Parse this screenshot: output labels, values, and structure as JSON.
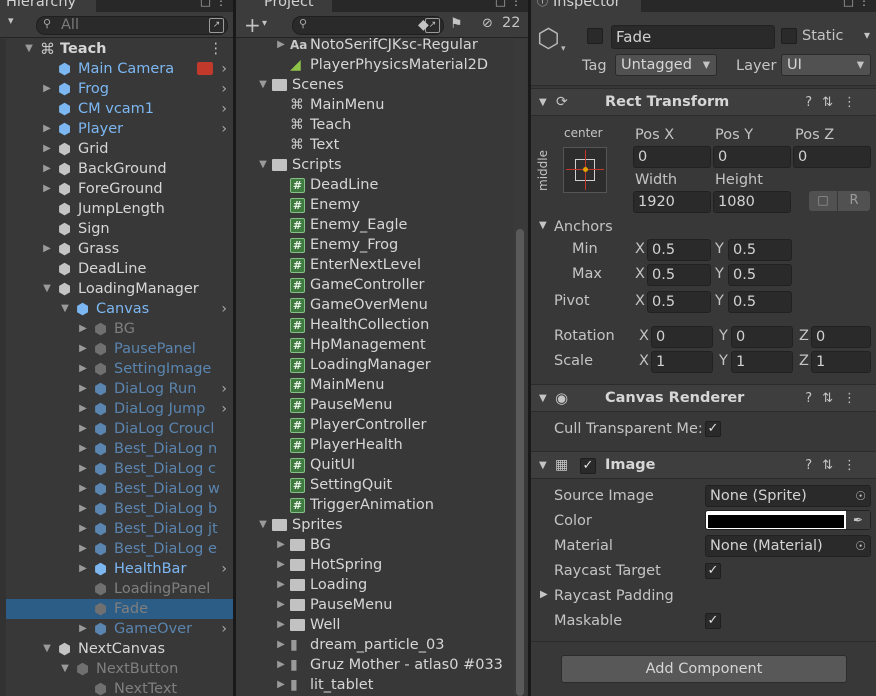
{
  "hierarchy": {
    "tab_label": "Hierarchy",
    "search_placeholder": "All",
    "add_label": "+",
    "rows": [
      {
        "label": "Teach",
        "indent": 1,
        "arrow": "down",
        "icon": "scene",
        "style": "white",
        "bold": true,
        "menu": true
      },
      {
        "label": "Main Camera",
        "indent": 2,
        "arrow": "",
        "icon": "cube-blue",
        "style": "blue",
        "chevron": true,
        "badge": true
      },
      {
        "label": "Frog",
        "indent": 2,
        "arrow": "right",
        "icon": "cube-blue",
        "style": "blue",
        "chevron": true
      },
      {
        "label": "CM vcam1",
        "indent": 2,
        "arrow": "",
        "icon": "cube-blue",
        "style": "blue",
        "chevron": true
      },
      {
        "label": "Player",
        "indent": 2,
        "arrow": "right",
        "icon": "cube-blue",
        "style": "blue",
        "chevron": true
      },
      {
        "label": "Grid",
        "indent": 2,
        "arrow": "right",
        "icon": "cube",
        "style": "white"
      },
      {
        "label": "BackGround",
        "indent": 2,
        "arrow": "right",
        "icon": "cube",
        "style": "white"
      },
      {
        "label": "ForeGround",
        "indent": 2,
        "arrow": "right",
        "icon": "cube",
        "style": "white"
      },
      {
        "label": "JumpLength",
        "indent": 2,
        "arrow": "",
        "icon": "cube",
        "style": "white"
      },
      {
        "label": "Sign",
        "indent": 2,
        "arrow": "",
        "icon": "cube",
        "style": "white"
      },
      {
        "label": "Grass",
        "indent": 2,
        "arrow": "right",
        "icon": "cube",
        "style": "white"
      },
      {
        "label": "DeadLine",
        "indent": 2,
        "arrow": "",
        "icon": "cube",
        "style": "white"
      },
      {
        "label": "LoadingManager",
        "indent": 2,
        "arrow": "down",
        "icon": "cube",
        "style": "white"
      },
      {
        "label": "Canvas",
        "indent": 3,
        "arrow": "down",
        "icon": "cube-blue",
        "style": "blue",
        "chevron": true
      },
      {
        "label": "BG",
        "indent": 4,
        "arrow": "right",
        "icon": "cube-dim",
        "style": "dim"
      },
      {
        "label": "PausePanel",
        "indent": 4,
        "arrow": "right",
        "icon": "cube-dim",
        "style": "dimblue"
      },
      {
        "label": "SettingImage",
        "indent": 4,
        "arrow": "right",
        "icon": "cube-dim",
        "style": "dimblue"
      },
      {
        "label": "DiaLog Run",
        "indent": 4,
        "arrow": "right",
        "icon": "cube-dimblue",
        "style": "dimblue",
        "chevron": true
      },
      {
        "label": "DiaLog Jump",
        "indent": 4,
        "arrow": "right",
        "icon": "cube-dimblue",
        "style": "dimblue",
        "chevron": true
      },
      {
        "label": "DiaLog Croucl",
        "indent": 4,
        "arrow": "right",
        "icon": "cube-dimblue",
        "style": "dimblue"
      },
      {
        "label": "Best_DiaLog n",
        "indent": 4,
        "arrow": "right",
        "icon": "cube-dimblue",
        "style": "dimblue"
      },
      {
        "label": "Best_DiaLog c",
        "indent": 4,
        "arrow": "right",
        "icon": "cube-dimblue",
        "style": "dimblue"
      },
      {
        "label": "Best_DiaLog w",
        "indent": 4,
        "arrow": "right",
        "icon": "cube-dimblue",
        "style": "dimblue"
      },
      {
        "label": "Best_DiaLog b",
        "indent": 4,
        "arrow": "right",
        "icon": "cube-dimblue",
        "style": "dimblue"
      },
      {
        "label": "Best_DiaLog jt",
        "indent": 4,
        "arrow": "right",
        "icon": "cube-dimblue",
        "style": "dimblue"
      },
      {
        "label": "Best_DiaLog e",
        "indent": 4,
        "arrow": "right",
        "icon": "cube-dimblue",
        "style": "dimblue"
      },
      {
        "label": "HealthBar",
        "indent": 4,
        "arrow": "right",
        "icon": "cube-blue",
        "style": "blue",
        "chevron": true
      },
      {
        "label": "LoadingPanel",
        "indent": 4,
        "arrow": "",
        "icon": "cube-dim",
        "style": "dim"
      },
      {
        "label": "Fade",
        "indent": 4,
        "arrow": "",
        "icon": "cube-dim",
        "style": "dim",
        "selected": true
      },
      {
        "label": "GameOver",
        "indent": 4,
        "arrow": "right",
        "icon": "cube-dimblue",
        "style": "dimblue",
        "chevron": true
      },
      {
        "label": "NextCanvas",
        "indent": 2,
        "arrow": "down",
        "icon": "cube",
        "style": "white"
      },
      {
        "label": "NextButton",
        "indent": 3,
        "arrow": "down",
        "icon": "cube-dim",
        "style": "dim"
      },
      {
        "label": "NextText",
        "indent": 4,
        "arrow": "",
        "icon": "cube-dim",
        "style": "dim"
      }
    ]
  },
  "project": {
    "tab_label": "Project",
    "add_label": "+",
    "hidden_count": "22",
    "rows": [
      {
        "label": "NotoSerifCJKsc-Regular",
        "indent": 2,
        "arrow": "right",
        "icon": "font"
      },
      {
        "label": "PlayerPhysicsMaterial2D",
        "indent": 2,
        "arrow": "",
        "icon": "physics"
      },
      {
        "label": "Scenes",
        "indent": 1,
        "arrow": "down",
        "icon": "folder"
      },
      {
        "label": "MainMenu",
        "indent": 2,
        "arrow": "",
        "icon": "scene"
      },
      {
        "label": "Teach",
        "indent": 2,
        "arrow": "",
        "icon": "scene"
      },
      {
        "label": "Text",
        "indent": 2,
        "arrow": "",
        "icon": "scene"
      },
      {
        "label": "Scripts",
        "indent": 1,
        "arrow": "down",
        "icon": "folder"
      },
      {
        "label": "DeadLine",
        "indent": 2,
        "arrow": "",
        "icon": "script"
      },
      {
        "label": "Enemy",
        "indent": 2,
        "arrow": "",
        "icon": "script"
      },
      {
        "label": "Enemy_Eagle",
        "indent": 2,
        "arrow": "",
        "icon": "script"
      },
      {
        "label": "Enemy_Frog",
        "indent": 2,
        "arrow": "",
        "icon": "script"
      },
      {
        "label": "EnterNextLevel",
        "indent": 2,
        "arrow": "",
        "icon": "script"
      },
      {
        "label": "GameController",
        "indent": 2,
        "arrow": "",
        "icon": "script"
      },
      {
        "label": "GameOverMenu",
        "indent": 2,
        "arrow": "",
        "icon": "script"
      },
      {
        "label": "HealthCollection",
        "indent": 2,
        "arrow": "",
        "icon": "script"
      },
      {
        "label": "HpManagement",
        "indent": 2,
        "arrow": "",
        "icon": "script"
      },
      {
        "label": "LoadingManager",
        "indent": 2,
        "arrow": "",
        "icon": "script"
      },
      {
        "label": "MainMenu",
        "indent": 2,
        "arrow": "",
        "icon": "script"
      },
      {
        "label": "PauseMenu",
        "indent": 2,
        "arrow": "",
        "icon": "script"
      },
      {
        "label": "PlayerController",
        "indent": 2,
        "arrow": "",
        "icon": "script"
      },
      {
        "label": "PlayerHealth",
        "indent": 2,
        "arrow": "",
        "icon": "script"
      },
      {
        "label": "QuitUI",
        "indent": 2,
        "arrow": "",
        "icon": "script"
      },
      {
        "label": "SettingQuit",
        "indent": 2,
        "arrow": "",
        "icon": "script"
      },
      {
        "label": "TriggerAnimation",
        "indent": 2,
        "arrow": "",
        "icon": "script"
      },
      {
        "label": "Sprites",
        "indent": 1,
        "arrow": "down",
        "icon": "folder"
      },
      {
        "label": "BG",
        "indent": 2,
        "arrow": "right",
        "icon": "folder"
      },
      {
        "label": "HotSpring",
        "indent": 2,
        "arrow": "right",
        "icon": "folder"
      },
      {
        "label": "Loading",
        "indent": 2,
        "arrow": "right",
        "icon": "folder"
      },
      {
        "label": "PauseMenu",
        "indent": 2,
        "arrow": "right",
        "icon": "folder"
      },
      {
        "label": "Well",
        "indent": 2,
        "arrow": "right",
        "icon": "folder"
      },
      {
        "label": "dream_particle_03",
        "indent": 2,
        "arrow": "right",
        "icon": "sprite"
      },
      {
        "label": "Gruz Mother - atlas0 #033",
        "indent": 2,
        "arrow": "right",
        "icon": "sprite"
      },
      {
        "label": "lit_tablet",
        "indent": 2,
        "arrow": "right",
        "icon": "sprite"
      }
    ]
  },
  "inspector": {
    "tab_label": "Inspector",
    "object_name": "Fade",
    "static_label": "Static",
    "tag_label": "Tag",
    "tag_value": "Untagged",
    "layer_label": "Layer",
    "layer_value": "UI",
    "rect_transform": {
      "title": "Rect Transform",
      "anchor_h": "center",
      "anchor_v": "middle",
      "pos_x_label": "Pos X",
      "pos_x": "0",
      "pos_y_label": "Pos Y",
      "pos_y": "0",
      "pos_z_label": "Pos Z",
      "pos_z": "0",
      "width_label": "Width",
      "width": "1920",
      "height_label": "Height",
      "height": "1080",
      "r_button": "R",
      "anchors_label": "Anchors",
      "min_label": "Min",
      "min_x": "0.5",
      "min_y": "0.5",
      "max_label": "Max",
      "max_x": "0.5",
      "max_y": "0.5",
      "pivot_label": "Pivot",
      "pivot_x": "0.5",
      "pivot_y": "0.5",
      "rotation_label": "Rotation",
      "rot_x": "0",
      "rot_y": "0",
      "rot_z": "0",
      "scale_label": "Scale",
      "scale_x": "1",
      "scale_y": "1",
      "scale_z": "1",
      "x": "X",
      "y": "Y",
      "z": "Z"
    },
    "canvas_renderer": {
      "title": "Canvas Renderer",
      "cull_label": "Cull Transparent Me:"
    },
    "image": {
      "title": "Image",
      "source_label": "Source Image",
      "source_value": "None (Sprite)",
      "color_label": "Color",
      "color_value": "#000000",
      "material_label": "Material",
      "material_value": "None (Material)",
      "raycast_target_label": "Raycast Target",
      "raycast_padding_label": "Raycast Padding",
      "maskable_label": "Maskable"
    },
    "add_component_label": "Add Component"
  }
}
